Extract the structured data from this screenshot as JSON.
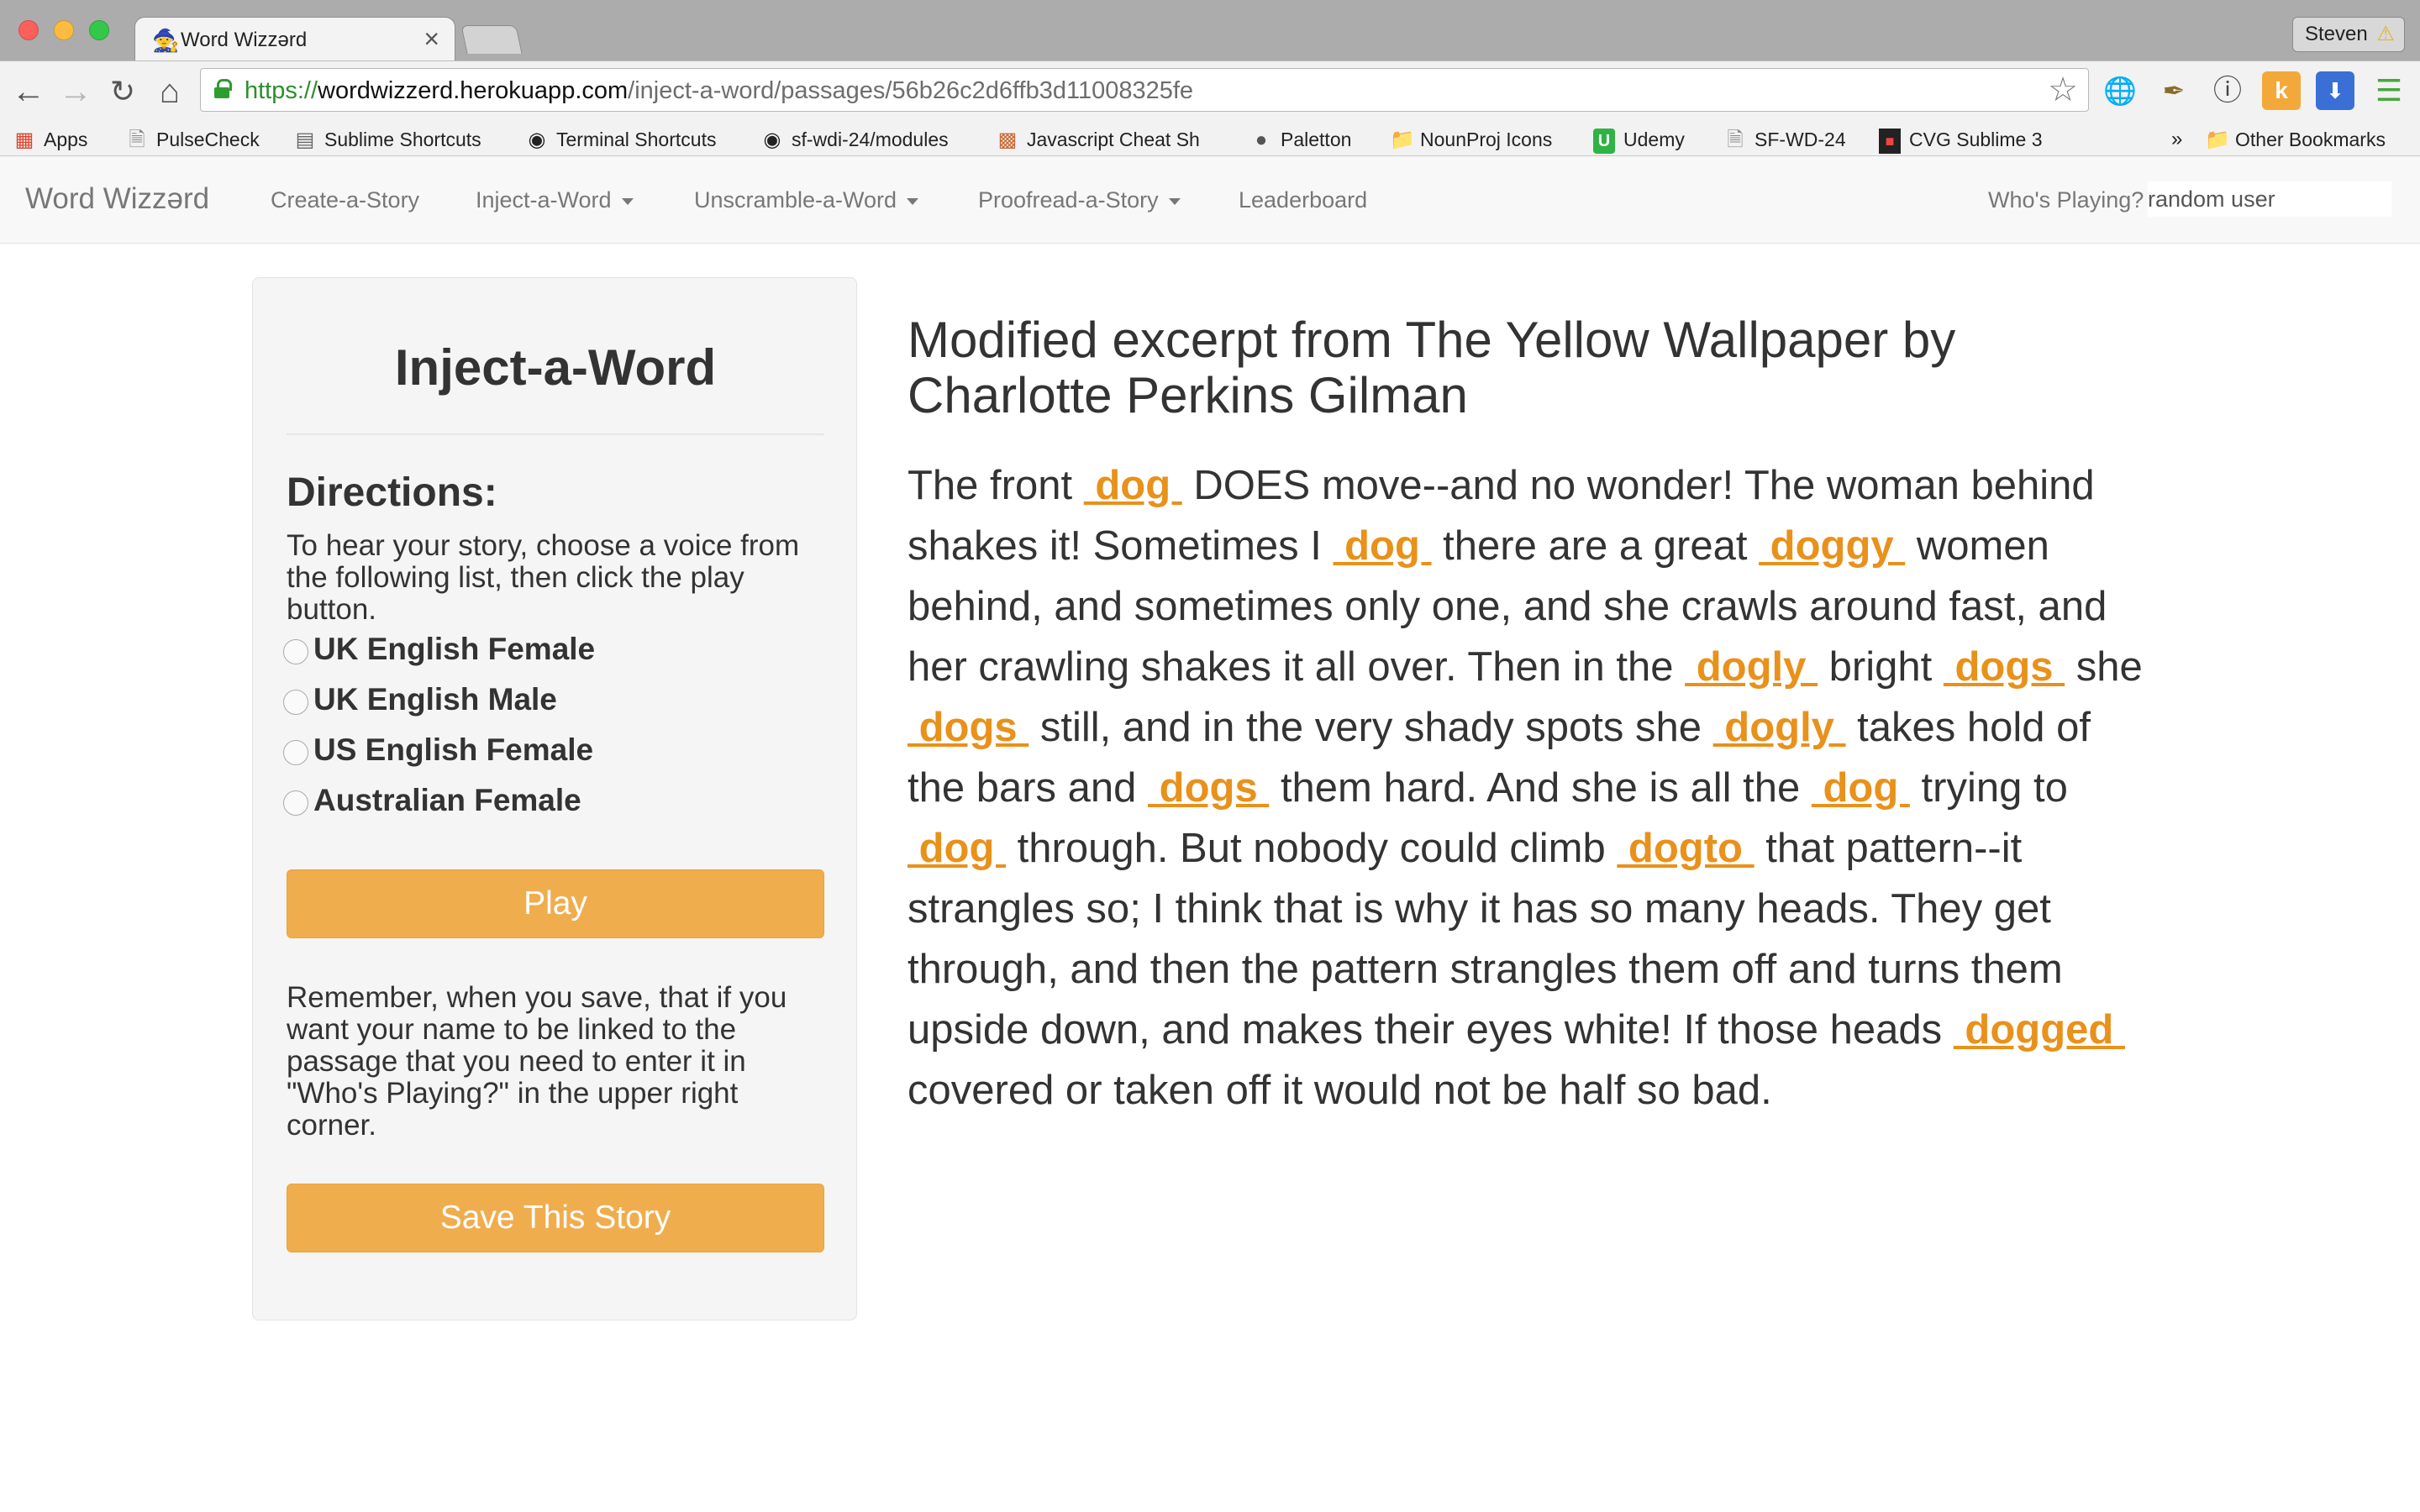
{
  "browser": {
    "tab_title": "Word Wizzərd",
    "profile_name": "Steven",
    "url_scheme": "https://",
    "url_host": "wordwizzerd.herokuapp.com",
    "url_path": "/inject-a-word/passages/56b26c2d6ffb3d11008325fe",
    "bookmarks": [
      {
        "label": "Apps",
        "icon": "apps-grid-icon"
      },
      {
        "label": "PulseCheck",
        "icon": "page-icon"
      },
      {
        "label": "Sublime Shortcuts",
        "icon": "sheet-icon"
      },
      {
        "label": "Terminal Shortcuts",
        "icon": "github-icon"
      },
      {
        "label": "sf-wdi-24/modules",
        "icon": "github-icon"
      },
      {
        "label": "Javascript Cheat Sh",
        "icon": "cheat-sheet-icon"
      },
      {
        "label": "Paletton",
        "icon": "paletton-icon"
      },
      {
        "label": "NounProj Icons",
        "icon": "folder-icon"
      },
      {
        "label": "Udemy",
        "icon": "udemy-icon"
      },
      {
        "label": "SF-WD-24",
        "icon": "page-icon"
      },
      {
        "label": "CVG Sublime 3",
        "icon": "cvg-icon"
      }
    ],
    "overflow_label": "»",
    "other_bookmarks": "Other Bookmarks"
  },
  "site_nav": {
    "brand": "Word Wizzərd",
    "items": [
      {
        "label": "Create-a-Story",
        "dropdown": false
      },
      {
        "label": "Inject-a-Word",
        "dropdown": true
      },
      {
        "label": "Unscramble-a-Word",
        "dropdown": true
      },
      {
        "label": "Proofread-a-Story",
        "dropdown": true
      },
      {
        "label": "Leaderboard",
        "dropdown": false
      }
    ],
    "who_label": "Who's Playing?",
    "who_value": "random user"
  },
  "sidebar": {
    "title": "Inject-a-Word",
    "directions_heading": "Directions:",
    "directions_text": "To hear your story, choose a voice from the following list, then click the play button.",
    "voices": [
      "UK English Female",
      "UK English Male",
      "US English Female",
      "Australian Female"
    ],
    "play_label": "Play",
    "remember_text": "Remember, when you save, that if you want your name to be linked to the passage that you need to enter it in \"Who's Playing?\" in the upper right corner.",
    "save_label": "Save This Story"
  },
  "passage": {
    "title": "Modified excerpt from The Yellow Wallpaper by Charlotte Perkins Gilman",
    "segments": [
      {
        "text": "The front "
      },
      {
        "word": " dog "
      },
      {
        "text": " DOES move--and no wonder! The woman behind shakes it! Sometimes I "
      },
      {
        "word": " dog "
      },
      {
        "text": " there are a great "
      },
      {
        "word": " doggy "
      },
      {
        "text": " women behind, and sometimes only one, and she crawls around fast, and her crawling shakes it all over. Then in the "
      },
      {
        "word": " dogly "
      },
      {
        "text": " bright "
      },
      {
        "word": " dogs "
      },
      {
        "text": " she "
      },
      {
        "word": " dogs "
      },
      {
        "text": " still, and in the very shady spots she "
      },
      {
        "word": " dogly "
      },
      {
        "text": " takes hold of the bars and "
      },
      {
        "word": " dogs "
      },
      {
        "text": " them hard. And she is all the "
      },
      {
        "word": " dog "
      },
      {
        "text": " trying to "
      },
      {
        "word": " dog "
      },
      {
        "text": " through. But nobody could climb "
      },
      {
        "word": " dogto "
      },
      {
        "text": " that pattern--it strangles so; I think that is why it has so many heads. They get through, and then the pattern strangles them off and turns them upside down, and makes their eyes white! If those heads "
      },
      {
        "word": " dogged "
      },
      {
        "text": " covered or taken off it would not be half so bad."
      }
    ]
  },
  "colors": {
    "accent_orange": "#f0ad4e",
    "injected_word": "#e8911b"
  }
}
